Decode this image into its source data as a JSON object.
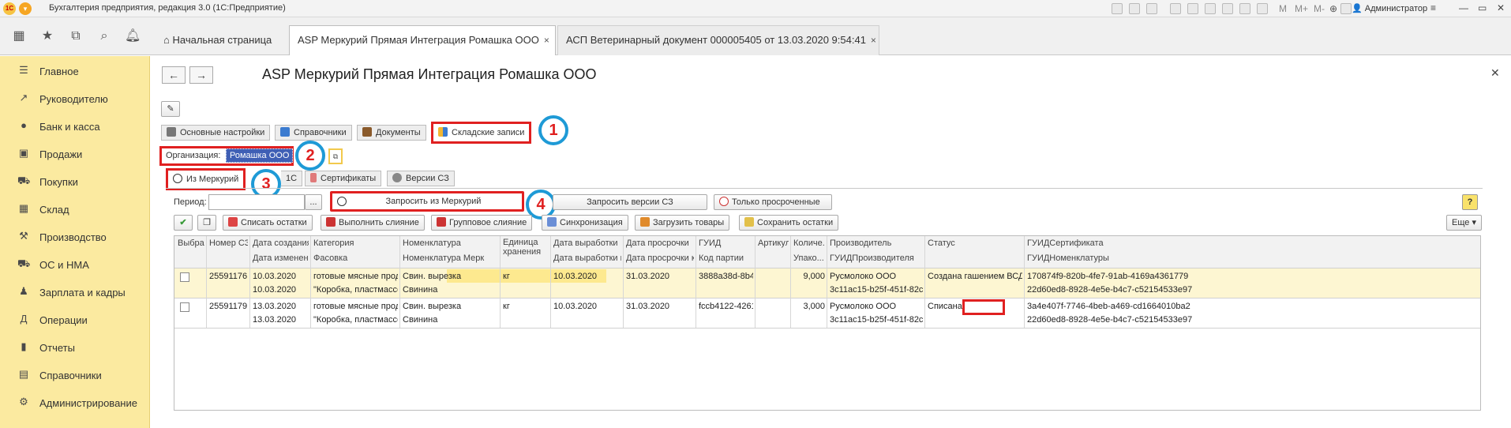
{
  "window": {
    "title": "Бухгалтерия предприятия, редакция 3.0 (1С:Предприятие)",
    "logo_text": "1С",
    "user": "Администратор",
    "toolbar_text": [
      "M",
      "M+",
      "M-"
    ]
  },
  "tabs": {
    "home": "Начальная страница",
    "items": [
      {
        "label": "ASP Меркурий Прямая Интеграция Ромашка ООО"
      },
      {
        "label": "АСП Ветеринарный документ 000005405 от 13.03.2020 9:54:41"
      }
    ],
    "close": "×"
  },
  "sidebar": {
    "items": [
      {
        "label": "Главное",
        "icon": "menu-icon"
      },
      {
        "label": "Руководителю",
        "icon": "trend-icon"
      },
      {
        "label": "Банк и касса",
        "icon": "coin-icon"
      },
      {
        "label": "Продажи",
        "icon": "bag-icon"
      },
      {
        "label": "Покупки",
        "icon": "cart-icon"
      },
      {
        "label": "Склад",
        "icon": "grid-icon"
      },
      {
        "label": "Производство",
        "icon": "factory-icon"
      },
      {
        "label": "ОС и НМА",
        "icon": "truck-icon"
      },
      {
        "label": "Зарплата и кадры",
        "icon": "person-icon"
      },
      {
        "label": "Операции",
        "icon": "ledger-icon"
      },
      {
        "label": "Отчеты",
        "icon": "bars-icon"
      },
      {
        "label": "Справочники",
        "icon": "book-icon"
      },
      {
        "label": "Администрирование",
        "icon": "gear-icon"
      }
    ]
  },
  "form": {
    "title": "ASP Меркурий Прямая Интеграция Ромашка ООО",
    "top_tabs": [
      "Основные настройки",
      "Справочники",
      "Документы",
      "Складские записи"
    ],
    "org_label": "Организация:",
    "org_value": "Ромашка ООО",
    "sub_tabs": [
      "Из Меркурий",
      "1С",
      "Сертификаты",
      "Версии СЗ"
    ],
    "period_label": "Период:",
    "period_dots": "...",
    "btn_request": "Запросить из Меркурий",
    "btn_versions": "Запросить версии СЗ",
    "btn_expired": "Только просроченные",
    "toolbar": [
      "Списать остатки",
      "Выполнить слияние",
      "Групповое слияние",
      "Синхронизация",
      "Загрузить товары",
      "Сохранить остатки"
    ],
    "more": "Еще"
  },
  "callouts": [
    "1",
    "2",
    "3",
    "4"
  ],
  "table": {
    "header_row1": [
      "Выбран",
      "Номер СЗ",
      "Дата создания",
      "Категория",
      "Номенклатура",
      "Единица хранения",
      "Дата выработки",
      "Дата просрочки",
      "ГУИД",
      "Артикул",
      "Количе...",
      "Производитель",
      "Статус",
      "ГУИДСертификата"
    ],
    "header_row2": [
      "",
      "",
      "Дата изменения",
      "Фасовка",
      "Номенклатура Мерк",
      "",
      "Дата выработки кон",
      "Дата просрочки кон",
      "Код партии",
      "",
      "Упако...",
      "ГУИДПроизводителя",
      "",
      "ГУИДНоменклатуры"
    ],
    "rows": [
      {
        "line1": [
          "",
          "25591176",
          "10.03.2020",
          "готовые мясные проду...",
          "Свин. вырезка",
          "кг",
          "10.03.2020",
          "31.03.2020",
          "3888a38d-8b4...",
          "",
          "9,000",
          "Русмолоко ООО",
          "Создана гашением ВСД",
          "170874f9-820b-4fe7-91ab-4169a4361779"
        ],
        "line2": [
          "",
          "",
          "10.03.2020",
          "\"Коробка, пластмассо...",
          "Свинина",
          "",
          "",
          "",
          "",
          "",
          "",
          "3c11ac15-b25f-451f-82cb-5f...",
          "",
          "22d60ed8-8928-4e5e-b4c7-c52154533e97"
        ]
      },
      {
        "line1": [
          "",
          "25591179",
          "13.03.2020",
          "готовые мясные проду...",
          "Свин. вырезка",
          "кг",
          "10.03.2020",
          "31.03.2020",
          "fccb4122-4261...",
          "",
          "3,000",
          "Русмолоко ООО",
          "Списана",
          "3a4e407f-7746-4beb-a469-cd1664010ba2"
        ],
        "line2": [
          "",
          "",
          "13.03.2020",
          "\"Коробка, пластмассо...",
          "Свинина",
          "",
          "",
          "",
          "",
          "",
          "",
          "3c11ac15-b25f-451f-82cb-5f...",
          "",
          "22d60ed8-8928-4e5e-b4c7-c52154533e97"
        ]
      }
    ]
  },
  "colors": {
    "sidebar_bg": "#fbeaa0",
    "highlight_row": "#fdf6d2",
    "nomen_highlight": "#fde98f",
    "annotation_red": "#e02020",
    "annotation_blue": "#1e9ad6"
  }
}
